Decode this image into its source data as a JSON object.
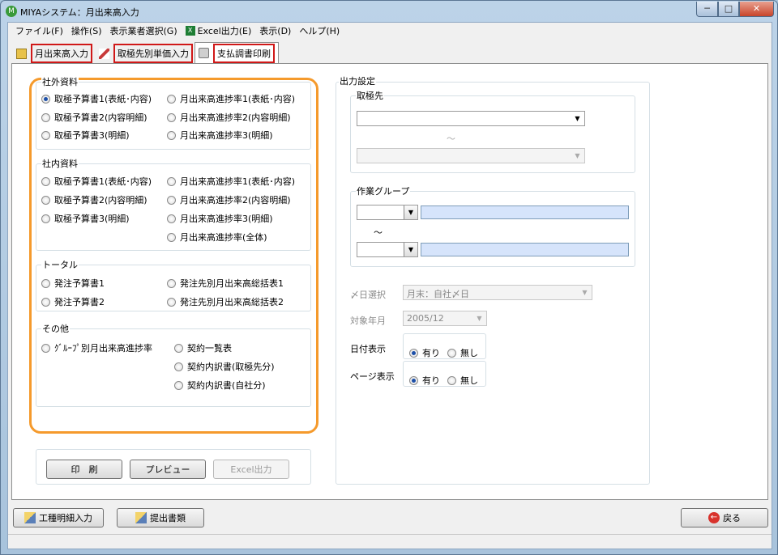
{
  "window": {
    "title": "MIYAシステム：月出来高入力",
    "min": "─",
    "max": "□",
    "close": "✕"
  },
  "menu": [
    "ファイル(F)",
    "操作(S)",
    "表示業者選択(G)",
    "Excel出力(E)",
    "表示(D)",
    "ヘルプ(H)"
  ],
  "tabs": [
    "月出来高入力",
    "取極先別単価入力",
    "支払調書印刷"
  ],
  "groups": {
    "external": {
      "title": "社外資料",
      "options": [
        "取極予算書1(表紙･内容)",
        "月出来高進捗率1(表紙･内容)",
        "取極予算書2(内容明細)",
        "月出来高進捗率2(内容明細)",
        "取極予算書3(明細)",
        "月出来高進捗率3(明細)"
      ]
    },
    "internal": {
      "title": "社内資料",
      "options": [
        "取極予算書1(表紙･内容)",
        "月出来高進捗率1(表紙･内容)",
        "取極予算書2(内容明細)",
        "月出来高進捗率2(内容明細)",
        "取極予算書3(明細)",
        "月出来高進捗率3(明細)",
        "月出来高進捗率(全体)"
      ]
    },
    "total": {
      "title": "トータル",
      "options": [
        "発注予算書1",
        "発注先別月出来高総括表1",
        "発注予算書2",
        "発注先別月出来高総括表2"
      ]
    },
    "other": {
      "title": "その他",
      "options": [
        "ｸﾞﾙｰﾌﾟ別月出来高進捗率",
        "契約一覧表",
        "契約内訳書(取極先分)",
        "契約内訳書(自社分)"
      ]
    }
  },
  "output": {
    "title": "出力設定",
    "partner_title": "取極先",
    "workgroup_title": "作業グループ",
    "tilde": "～",
    "date_select_label": "〆日選択",
    "date_select_value": "月末：自社〆日",
    "target_month_label": "対象年月",
    "target_month_value": "2005/12",
    "date_display_label": "日付表示",
    "page_display_label": "ページ表示",
    "yes": "有り",
    "no": "無し"
  },
  "buttons": {
    "print": "印　刷",
    "preview": "プレビュー",
    "excel": "Excel出力",
    "work_detail": "工種明細入力",
    "submit_docs": "提出書類",
    "back": "戻る"
  },
  "colors": {
    "accent_orange": "#f59a2c",
    "highlight_red": "#d01818"
  }
}
